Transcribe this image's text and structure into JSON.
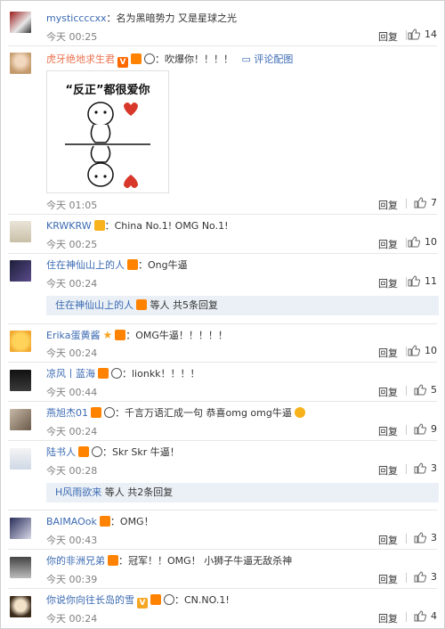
{
  "comments": [
    {
      "user": "mysticcccxx",
      "text": "名为黑暗势力 又是星球之光",
      "time": "今天 00:25",
      "reply": "回复",
      "likes": "14"
    },
    {
      "user": "虎牙绝地求生君",
      "text": "吹爆你！！！！",
      "pic_link": "评论配图",
      "time": "今天 01:05",
      "reply": "回复",
      "likes": "7",
      "sticker": {
        "caption": "“反正”都很爱你"
      }
    },
    {
      "user": "KRWKRW",
      "text": "China No.1!  OMG No.1!",
      "time": "今天 00:25",
      "reply": "回复",
      "likes": "10"
    },
    {
      "user": "住在神仙山上的人",
      "text": "Ong牛逼",
      "time": "今天 00:24",
      "reply": "回复",
      "likes": "11",
      "sub": {
        "user": "住在神仙山上的人",
        "rest": "等人 共5条回复"
      }
    },
    {
      "user": "Erika蛋黄酱",
      "text": "OMG牛逼！！！！！",
      "time": "今天 00:24",
      "reply": "回复",
      "likes": "10"
    },
    {
      "user": "凉风丨蓝海",
      "text": "lionkk！！！！",
      "time": "今天 00:44",
      "reply": "回复",
      "likes": "5"
    },
    {
      "user": "燕旭杰01",
      "text": "千言万语汇成一句 恭喜omg omg牛逼",
      "time": "今天 00:24",
      "reply": "回复",
      "likes": "9"
    },
    {
      "user": "陆书人",
      "text": "Skr  Skr  牛逼！",
      "time": "今天 00:28",
      "reply": "回复",
      "likes": "3",
      "sub": {
        "user": "H风雨欲来",
        "rest": "等人 共2条回复"
      }
    },
    {
      "user": "BAIMAOok",
      "text": "OMG！",
      "time": "今天 00:43",
      "reply": "回复",
      "likes": "3"
    },
    {
      "user": "你的非洲兄弟",
      "text": "冠军！！OMG！ 小狮子牛逼无敌杀神",
      "time": "今天 00:39",
      "reply": "回复",
      "likes": "3"
    },
    {
      "user": "你说你向往长岛的雪",
      "text": "CN.NO.1!",
      "time": "今天 00:24",
      "reply": "回复",
      "likes": "4"
    }
  ],
  "colors": {
    "username": "#eb7350",
    "link": "#3b6ab2",
    "meta": "#808080",
    "subbox": "#eaf0f6"
  },
  "icons": {
    "like": "thumbs-up-icon",
    "pic": "image-icon"
  }
}
